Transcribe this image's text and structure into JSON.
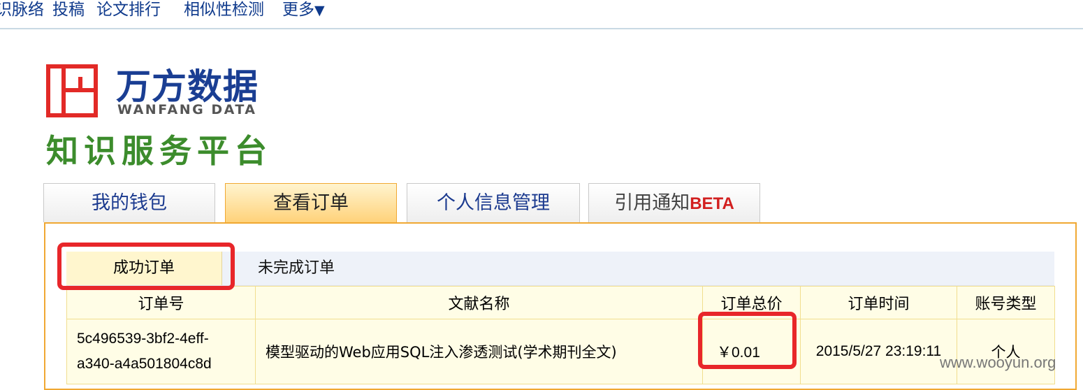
{
  "nav": {
    "items": [
      "识脉络",
      "投稿",
      "论文排行",
      "相似性检测",
      "更多"
    ],
    "more_caret": "▼"
  },
  "logo": {
    "brand_cn": "万方数据",
    "brand_en": "WANFANG DATA",
    "platform": "知识服务平台"
  },
  "tabs": [
    {
      "label": "我的钱包",
      "active": false
    },
    {
      "label": "查看订单",
      "active": true
    },
    {
      "label": "个人信息管理",
      "active": false
    },
    {
      "label": "引用通知",
      "badge": "BETA",
      "active": false
    }
  ],
  "subtabs": {
    "success": "成功订单",
    "pending": "未完成订单"
  },
  "table": {
    "headers": [
      "订单号",
      "文献名称",
      "订单总价",
      "订单时间",
      "账号类型"
    ],
    "rows": [
      {
        "id_line1": "5c496539-3bf2-4eff-",
        "id_line2": "a340-a4a501804c8d",
        "title": "模型驱动的Web应用SQL注入渗透测试(学术期刊全文)",
        "price": "￥0.01",
        "time": "2015/5/27 23:19:11",
        "type": "个人"
      }
    ]
  },
  "watermark": "www.wooyun.org",
  "colors": {
    "highlight": "#e8262a",
    "accent": "#f0a832",
    "link_purple": "#800d80",
    "brand_blue": "#1a3e93",
    "brand_green": "#3c8c2c"
  }
}
